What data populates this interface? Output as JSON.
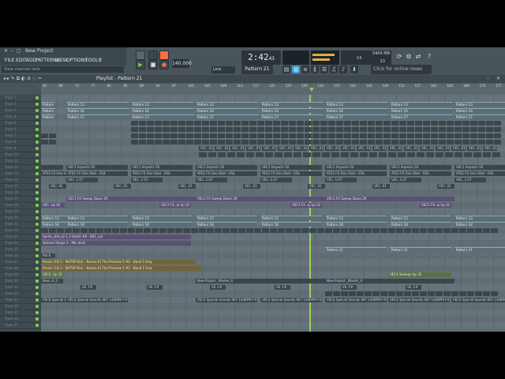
{
  "titlebar": {
    "title": "New Project"
  },
  "menu": [
    "FILE",
    "EDIT",
    "ADD",
    "PATTERNS",
    "VIEW",
    "OPTIONS",
    "TOOLS",
    "?"
  ],
  "hint": "View channel rack",
  "transport": {
    "tempo": "140.000",
    "time": "2:42",
    "time_sub": "43",
    "mode": "PAT"
  },
  "cpu": {
    "top": "5404 MB",
    "mid": "14",
    "bottom": "23"
  },
  "pattern_selector": "Pattern 21",
  "line_selector": "Line",
  "news": "Click for online news",
  "playlist": {
    "title": "Playlist - Pattern 21"
  },
  "ruler": [
    "65",
    "69",
    "73",
    "77",
    "81",
    "85",
    "89",
    "93",
    "97",
    "101",
    "105",
    "109",
    "113",
    "117",
    "121",
    "125",
    "129",
    "133",
    "137",
    "141",
    "145",
    "149",
    "153",
    "157",
    "161",
    "165",
    "169",
    "173",
    "177"
  ],
  "tracks": [
    "Track 1",
    "Track 2",
    "Track 3",
    "Track 4",
    "Track 5",
    "Track 6",
    "Track 7",
    "Track 8",
    "Track 9",
    "Track 10",
    "Track 11",
    "Track 12",
    "Track 13",
    "Track 14",
    "Track 15",
    "Track 16",
    "Track 17",
    "Track 18",
    "Track 19",
    "Track 20",
    "Track 21",
    "Track 22",
    "Track 23",
    "Track 24",
    "Track 25",
    "Track 26",
    "Track 27",
    "Track 28",
    "Track 29",
    "Track 30",
    "Track 31",
    "Track 32",
    "Track 33",
    "Track 34",
    "Track 35",
    "Track 36",
    "Track 37"
  ],
  "clips": {
    "pat13": "Pattern 13",
    "pat16": "Pattern 16",
    "pat17": "Pattern 17",
    "pat18": "Pattern 18",
    "pat21": "Pattern 21",
    "vec": "VEC1 Impacts 50",
    "ate": "ATE2 FX One Shot - 054",
    "sweep": "VEC3 FX Sweep Down 29",
    "vec3fx": "VEC3 FX..ip Up 02",
    "vol": "Volume Shape 3 - Mix level",
    "param1": "Param: EQ 1 - NUTSP Kick - Karma X) The Promise 5 #2 - Band 1 freq",
    "param2": "Param: EQ 1 - NUTSP Kick - Karma X) The Promise 5 #2 - Band 1 freq",
    "project": "New Project _Master_6",
    "special": "VEC4 Special Sounds 067 140BPM F#",
    "sweepup": "VEC4 Sweeps Up 32"
  },
  "colors": {
    "playhead": "#a5e35a",
    "accent": "#ff6e40"
  }
}
